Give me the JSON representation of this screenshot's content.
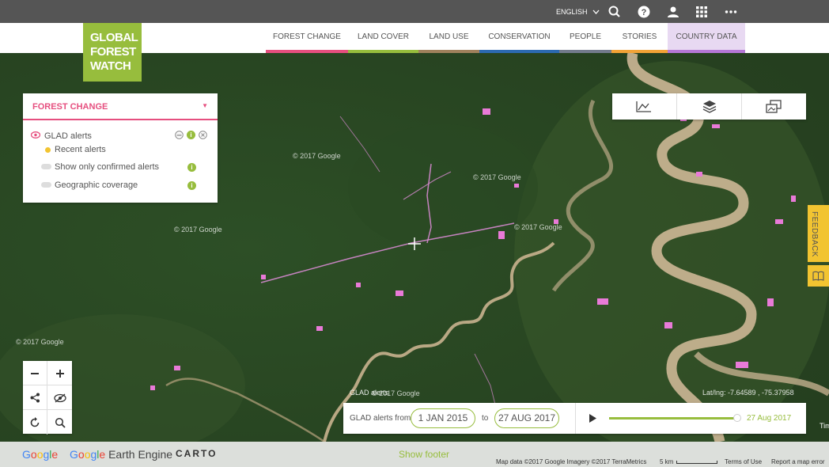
{
  "topbar": {
    "language": "ENGLISH",
    "icons": [
      "search-icon",
      "help-icon",
      "user-icon",
      "apps-grid-icon",
      "more-icon"
    ]
  },
  "logo": {
    "line1": "GLOBAL",
    "line2": "FOREST",
    "line3": "WATCH"
  },
  "nav": {
    "items": [
      {
        "label": "FOREST CHANGE",
        "color": "#e64f7f"
      },
      {
        "label": "LAND COVER",
        "color": "#97bd3d"
      },
      {
        "label": "LAND USE",
        "color": "#a0815c"
      },
      {
        "label": "CONSERVATION",
        "color": "#2c6ab1"
      },
      {
        "label": "PEOPLE",
        "color": "#737b8c"
      },
      {
        "label": "STORIES",
        "color": "#f2a336"
      },
      {
        "label": "COUNTRY DATA",
        "color": "#b577d6"
      }
    ]
  },
  "panel": {
    "title": "FOREST CHANGE",
    "layer": "GLAD alerts",
    "legend": "Recent alerts",
    "legend_color": "#f2c431",
    "option1": "Show only confirmed alerts",
    "option2": "Geographic coverage"
  },
  "tools": {
    "icons": [
      "analysis-chart-icon",
      "layers-icon",
      "basemap-icon"
    ]
  },
  "feedback": {
    "label": "FEEDBACK"
  },
  "map": {
    "watermark": "© 2017 Google",
    "layer_label": "GLAD alerts",
    "latlng": "Lat/lng: -7.64589 , -75.37958",
    "edge_text": "Tim"
  },
  "timeline": {
    "prefix": "GLAD alerts from",
    "start": "1 JAN 2015",
    "connector": "to",
    "end": "27 AUG 2017",
    "current": "27  Aug  2017",
    "progress": 1.0
  },
  "footer": {
    "google": "Google",
    "earth_engine_g": "Google",
    "earth_engine": "Earth Engine",
    "carto": "CARTO",
    "show_footer": "Show footer",
    "map_data": "Map data ©2017 Google Imagery ©2017 TerraMetrics",
    "scale": "5 km",
    "terms": "Terms of Use",
    "report": "Report a map error"
  },
  "colors": {
    "accent_green": "#97bd3d",
    "accent_pink": "#e64f7f",
    "alerts_pink": "#e97ad8",
    "river": "#cdb796",
    "forest": "#2f5127"
  }
}
